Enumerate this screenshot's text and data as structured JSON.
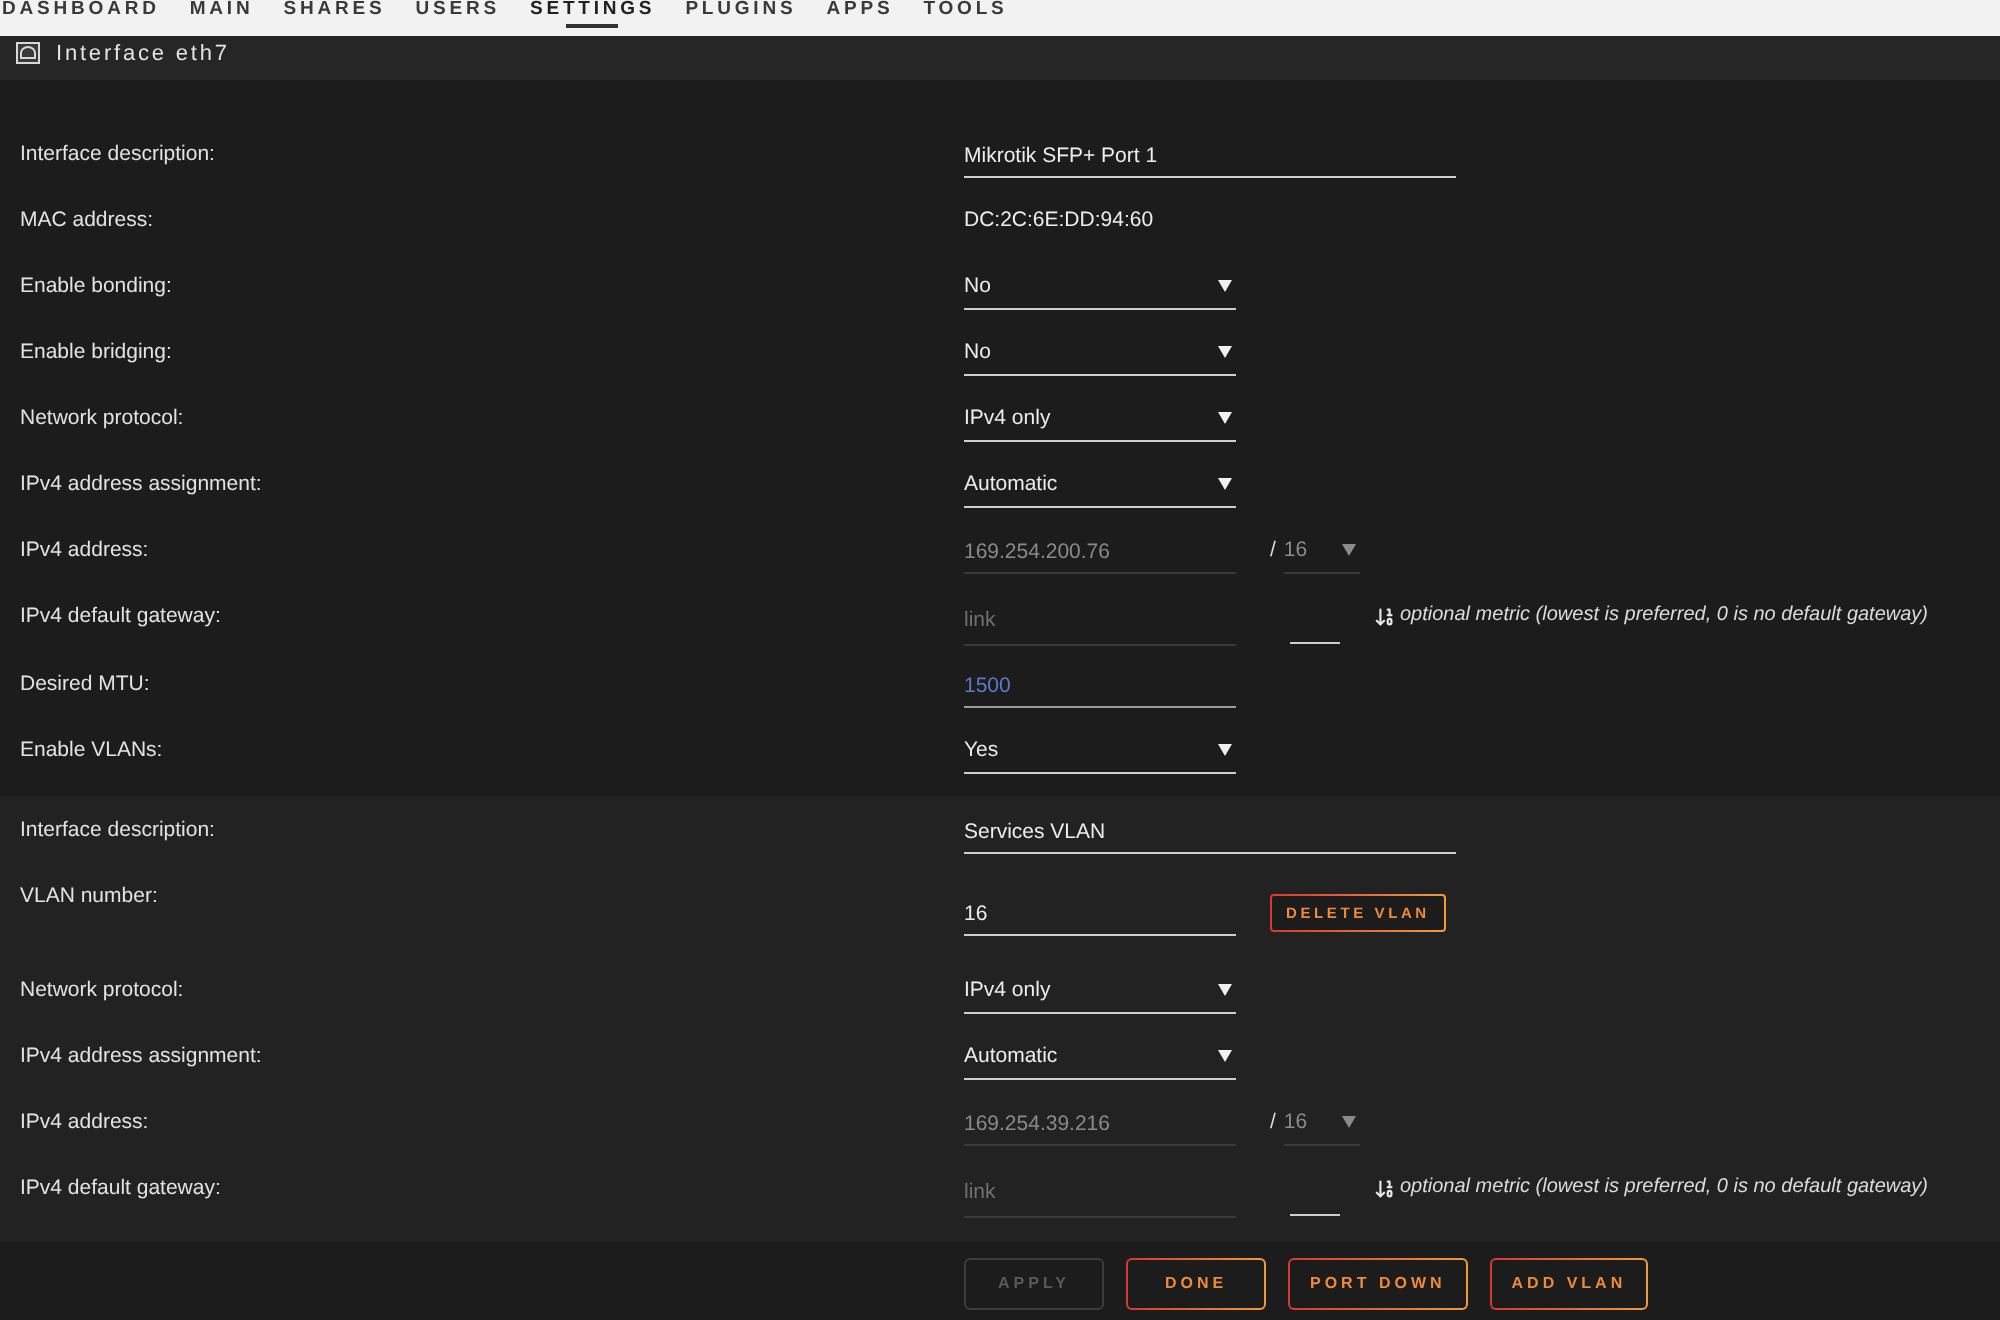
{
  "nav": {
    "items": [
      {
        "label": "DASHBOARD",
        "selected": false
      },
      {
        "label": "MAIN",
        "selected": false
      },
      {
        "label": "SHARES",
        "selected": false
      },
      {
        "label": "USERS",
        "selected": false
      },
      {
        "label": "SETTINGS",
        "selected": true
      },
      {
        "label": "PLUGINS",
        "selected": false
      },
      {
        "label": "APPS",
        "selected": false
      },
      {
        "label": "TOOLS",
        "selected": false
      }
    ]
  },
  "header": {
    "title": "Interface eth7"
  },
  "interface": {
    "fields": [
      {
        "kind": "text",
        "label": "Interface description:",
        "value": "Mikrotik SFP+ Port 1"
      },
      {
        "kind": "static",
        "label": "MAC address:",
        "value": "DC:2C:6E:DD:94:60"
      },
      {
        "kind": "select",
        "label": "Enable bonding:",
        "value": "No"
      },
      {
        "kind": "select",
        "label": "Enable bridging:",
        "value": "No"
      },
      {
        "kind": "select",
        "label": "Network protocol:",
        "value": "IPv4 only"
      },
      {
        "kind": "select",
        "label": "IPv4 address assignment:",
        "value": "Automatic"
      },
      {
        "kind": "address",
        "label": "IPv4 address:",
        "value": "169.254.200.76",
        "disabled": true,
        "separator": "/",
        "prefix": "16"
      },
      {
        "kind": "gateway",
        "label": "IPv4 default gateway:",
        "placeholder": "link",
        "disabled": true,
        "note": "optional metric (lowest is preferred, 0 is no default gateway)"
      },
      {
        "kind": "number",
        "label": "Desired MTU:",
        "value": "1500",
        "highlighted": true
      },
      {
        "kind": "select",
        "label": "Enable VLANs:",
        "value": "Yes"
      }
    ]
  },
  "vlan": {
    "fields": [
      {
        "kind": "text",
        "label": "Interface description:",
        "value": "Services VLAN"
      },
      {
        "kind": "vlan_number",
        "label": "VLAN number:",
        "value": "16",
        "button": "DELETE VLAN"
      },
      {
        "kind": "select",
        "label": "Network protocol:",
        "value": "IPv4 only"
      },
      {
        "kind": "select",
        "label": "IPv4 address assignment:",
        "value": "Automatic"
      },
      {
        "kind": "address",
        "label": "IPv4 address:",
        "value": "169.254.39.216",
        "disabled": true,
        "separator": "/",
        "prefix": "16"
      },
      {
        "kind": "gateway",
        "label": "IPv4 default gateway:",
        "placeholder": "link",
        "disabled": true,
        "note": "optional metric (lowest is preferred, 0 is no default gateway)"
      }
    ]
  },
  "buttons": [
    {
      "label": "APPLY",
      "disabled": true
    },
    {
      "label": "DONE",
      "disabled": false
    },
    {
      "label": "PORT DOWN",
      "disabled": false
    },
    {
      "label": "ADD VLAN",
      "disabled": false
    }
  ]
}
